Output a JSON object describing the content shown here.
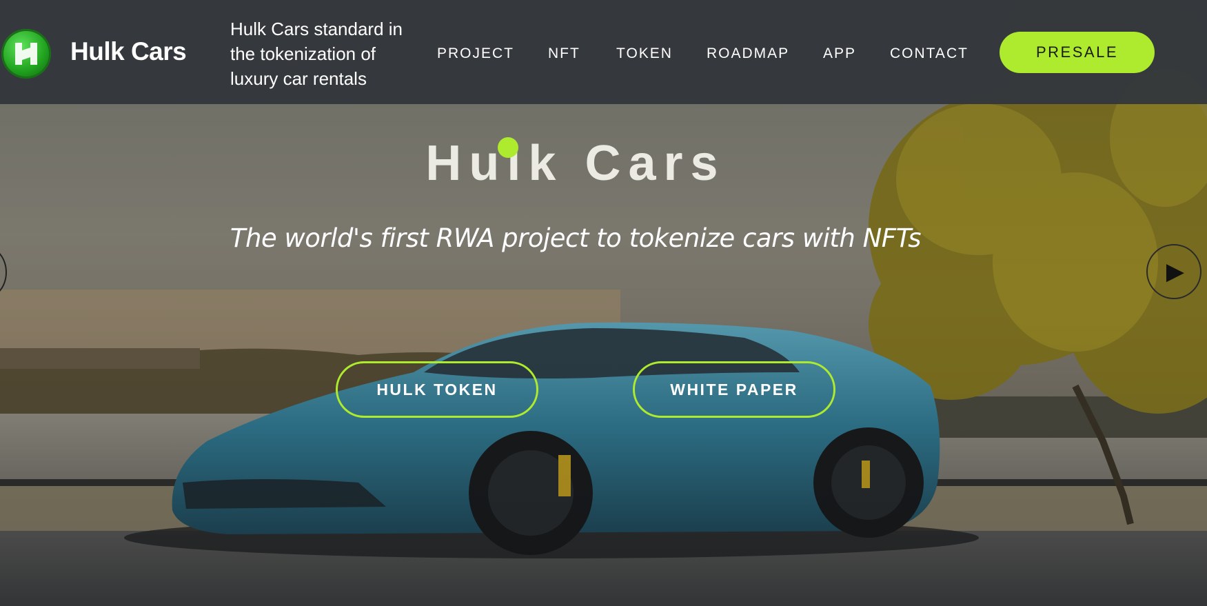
{
  "brand": {
    "name": "Hulk Cars",
    "logo_icon": "hulk-h-logo-icon"
  },
  "tagline": "Hulk Cars standard in the tokenization of luxury car rentals",
  "nav": {
    "items": [
      {
        "label": "PROJECT"
      },
      {
        "label": "NFT"
      },
      {
        "label": "TOKEN"
      },
      {
        "label": "ROADMAP"
      },
      {
        "label": "APP"
      },
      {
        "label": "CONTACT"
      }
    ],
    "cta_label": "PRESALE"
  },
  "hero": {
    "title": "Hulk Cars",
    "subtitle": "The world's first RWA project to tokenize cars with NFTs",
    "buttons": [
      {
        "label": "HULK TOKEN"
      },
      {
        "label": "WHITE PAPER"
      }
    ],
    "slider_prev_icon": "arrow-left-icon",
    "slider_next_icon": "play-arrow-right-icon"
  },
  "colors": {
    "accent": "#aeea2e",
    "header_bg": "#34383c",
    "car": "#3d8ea8"
  }
}
